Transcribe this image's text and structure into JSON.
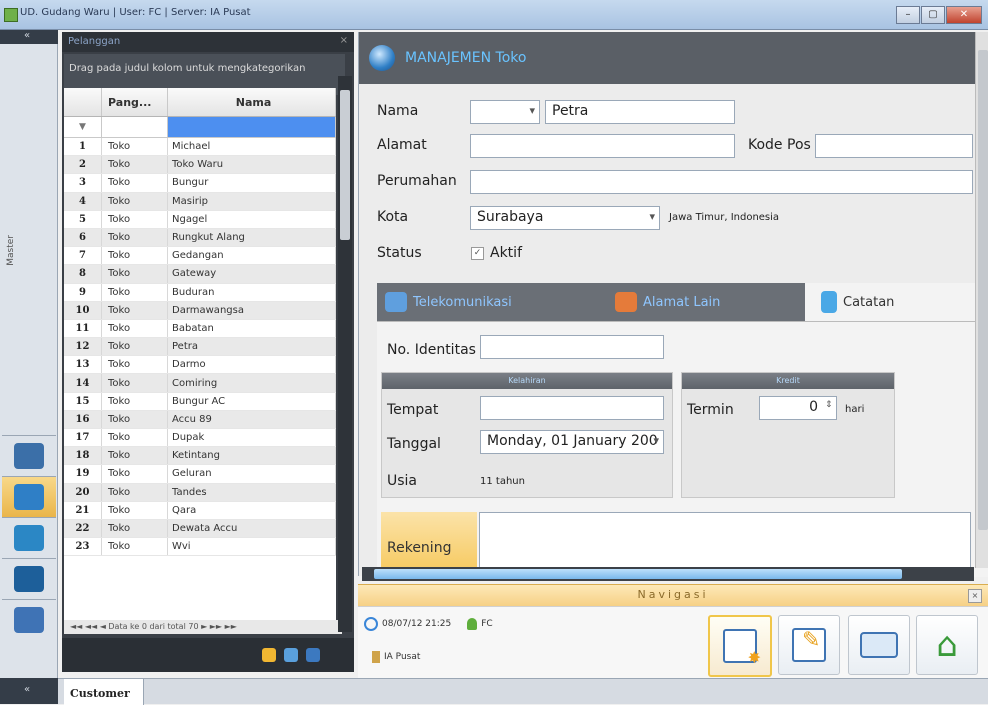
{
  "window": {
    "title": "UD. Gudang Waru  |  User: FC  |  Server: IA Pusat",
    "buttons": [
      "–",
      "▢",
      "✕"
    ]
  },
  "sidebar": {
    "top_label": "«",
    "vertical_label": "Master",
    "bottom_label": "«",
    "items": [
      {
        "icon": "printer-scanner-icon",
        "color": "#3b6fa8",
        "active": false
      },
      {
        "icon": "customer-globe-icon",
        "color": "#2f7fc6",
        "active": true
      },
      {
        "icon": "supplier-box-icon",
        "color": "#2b87c5",
        "active": false
      },
      {
        "icon": "folder-icon",
        "color": "#1d5f9a",
        "active": false
      },
      {
        "icon": "user-tools-icon",
        "color": "#3f73b5",
        "active": false
      }
    ]
  },
  "list_panel": {
    "header": "Pelanggan",
    "group_hint": "Drag pada judul kolom untuk mengkategorikan",
    "columns": [
      "Pang...",
      "Nama"
    ],
    "rows": [
      {
        "no": "1",
        "pang": "Toko",
        "nama": "Michael"
      },
      {
        "no": "2",
        "pang": "Toko",
        "nama": "Toko Waru"
      },
      {
        "no": "3",
        "pang": "Toko",
        "nama": "Bungur"
      },
      {
        "no": "4",
        "pang": "Toko",
        "nama": "Masirip"
      },
      {
        "no": "5",
        "pang": "Toko",
        "nama": "Ngagel"
      },
      {
        "no": "6",
        "pang": "Toko",
        "nama": "Rungkut Alang"
      },
      {
        "no": "7",
        "pang": "Toko",
        "nama": "Gedangan"
      },
      {
        "no": "8",
        "pang": "Toko",
        "nama": "Gateway"
      },
      {
        "no": "9",
        "pang": "Toko",
        "nama": "Buduran"
      },
      {
        "no": "10",
        "pang": "Toko",
        "nama": "Darmawangsa"
      },
      {
        "no": "11",
        "pang": "Toko",
        "nama": "Babatan"
      },
      {
        "no": "12",
        "pang": "Toko",
        "nama": "Petra"
      },
      {
        "no": "13",
        "pang": "Toko",
        "nama": "Darmo"
      },
      {
        "no": "14",
        "pang": "Toko",
        "nama": "Comiring"
      },
      {
        "no": "15",
        "pang": "Toko",
        "nama": "Bungur AC"
      },
      {
        "no": "16",
        "pang": "Toko",
        "nama": "Accu 89"
      },
      {
        "no": "17",
        "pang": "Toko",
        "nama": "Dupak"
      },
      {
        "no": "18",
        "pang": "Toko",
        "nama": "Ketintang"
      },
      {
        "no": "19",
        "pang": "Toko",
        "nama": "Geluran"
      },
      {
        "no": "20",
        "pang": "Toko",
        "nama": "Tandes"
      },
      {
        "no": "21",
        "pang": "Toko",
        "nama": "Qara"
      },
      {
        "no": "22",
        "pang": "Toko",
        "nama": "Dewata Accu"
      },
      {
        "no": "23",
        "pang": "Toko",
        "nama": "Wvi"
      }
    ],
    "nav_text": "◄◄ ◄◄ ◄  Data ke 0 dari total 70  ► ►► ►►"
  },
  "form": {
    "title": "MANAJEMEN Toko",
    "nama_label": "Nama",
    "nama_prefix": "",
    "nama_value": "Petra",
    "alamat_label": "Alamat",
    "alamat_value": "",
    "kodepos_label": "Kode Pos",
    "kodepos_value": "",
    "perumahan_label": "Perumahan",
    "perumahan_value": "",
    "kota_label": "Kota",
    "kota_value": "Surabaya",
    "kota_region": "Jawa Timur, Indonesia",
    "status_label": "Status",
    "aktif_label": "Aktif",
    "aktif_checked": true,
    "tabs": [
      {
        "label": "Telekomunikasi",
        "icon": "telephone-icon",
        "active": false
      },
      {
        "label": "Alamat Lain",
        "icon": "house-icon",
        "active": false
      },
      {
        "label": "Catatan",
        "icon": "note-icon",
        "active": true
      }
    ],
    "identitas_label": "No. Identitas",
    "identitas_value": "",
    "lahir_group": "Kelahiran",
    "tempat_label": "Tempat",
    "tempat_value": "",
    "tanggal_label": "Tanggal",
    "tanggal_value": "Monday, 01 January 200",
    "usia_label": "Usia",
    "usia_value": "11 tahun",
    "kredit_group": "Kredit",
    "termin_label": "Termin",
    "termin_value": "0",
    "termin_unit": "hari",
    "rekening_label": "Rekening"
  },
  "navigation": {
    "title": "Navigasi",
    "datetime": "08/07/12 21:25",
    "user": "FC",
    "location": "IA Pusat",
    "buttons": [
      {
        "name": "new-record-button",
        "icon": "new-document-icon",
        "active": true
      },
      {
        "name": "edit-button",
        "icon": "pencil-edit-icon",
        "active": false
      },
      {
        "name": "print-button",
        "icon": "printer-icon",
        "active": false
      },
      {
        "name": "home-button",
        "icon": "home-icon",
        "active": false
      }
    ]
  },
  "bottom_tabs": [
    "Customer"
  ]
}
